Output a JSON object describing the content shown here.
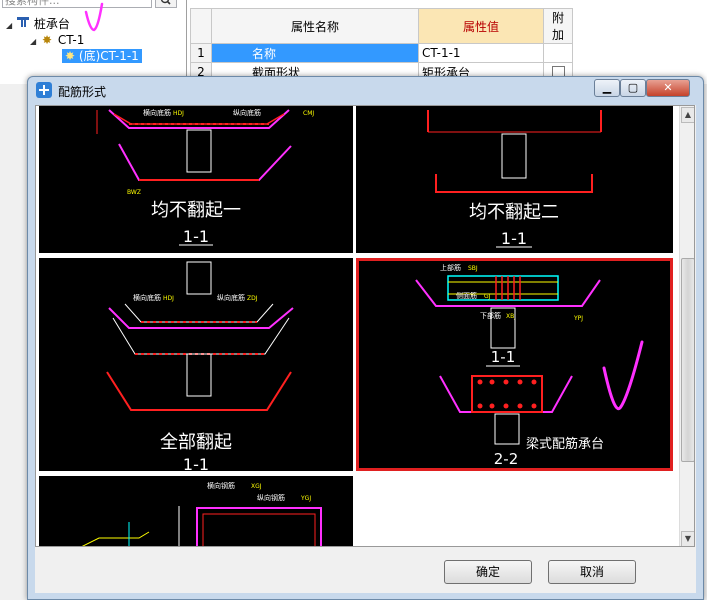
{
  "tree": {
    "search_placeholder": "搜索构件...",
    "items": [
      {
        "label": "桩承台"
      },
      {
        "label": "CT-1"
      },
      {
        "label": "(底)CT-1-1"
      }
    ]
  },
  "properties": {
    "headers": [
      "属性名称",
      "属性值",
      "附加"
    ],
    "rows": [
      {
        "num": "1",
        "name": "名称",
        "value": "CT-1-1"
      },
      {
        "num": "2",
        "name": "截面形状",
        "value": "矩形承台"
      }
    ]
  },
  "dialog": {
    "title": "配筋形式",
    "ok_label": "确定",
    "cancel_label": "取消",
    "options": [
      {
        "title": "均不翻起一",
        "section": "1-1",
        "selected": false
      },
      {
        "title": "均不翻起二",
        "section": "1-1",
        "selected": false
      },
      {
        "title": "全部翻起",
        "section": "1-1",
        "selected": false
      },
      {
        "title": "梁式配筋承台",
        "section_top": "1-1",
        "section_bottom": "2-2",
        "selected": true
      },
      {
        "title": "",
        "section": "",
        "selected": false
      }
    ],
    "annotations": {
      "hengxiang": "横向底筋",
      "zongxiang": "纵向底筋",
      "hengxiang_gang": "横向钢筋",
      "zongxiang_gang": "纵向钢筋",
      "shangbu": "上部筋",
      "xiabu": "下部筋",
      "ceji": "侧面筋",
      "codes": [
        "HDJ",
        "ZDJ",
        "CMJ",
        "XGJ",
        "YGJ",
        "SBJ",
        "XBJ",
        "YPJ",
        "BWZ",
        "GJ"
      ]
    }
  },
  "colors": {
    "selection": "#3399ff",
    "rebar_red": "#ff2020",
    "rebar_magenta": "#ff30ff",
    "highlight_border": "#e02020",
    "header_highlight": "#b80000"
  }
}
